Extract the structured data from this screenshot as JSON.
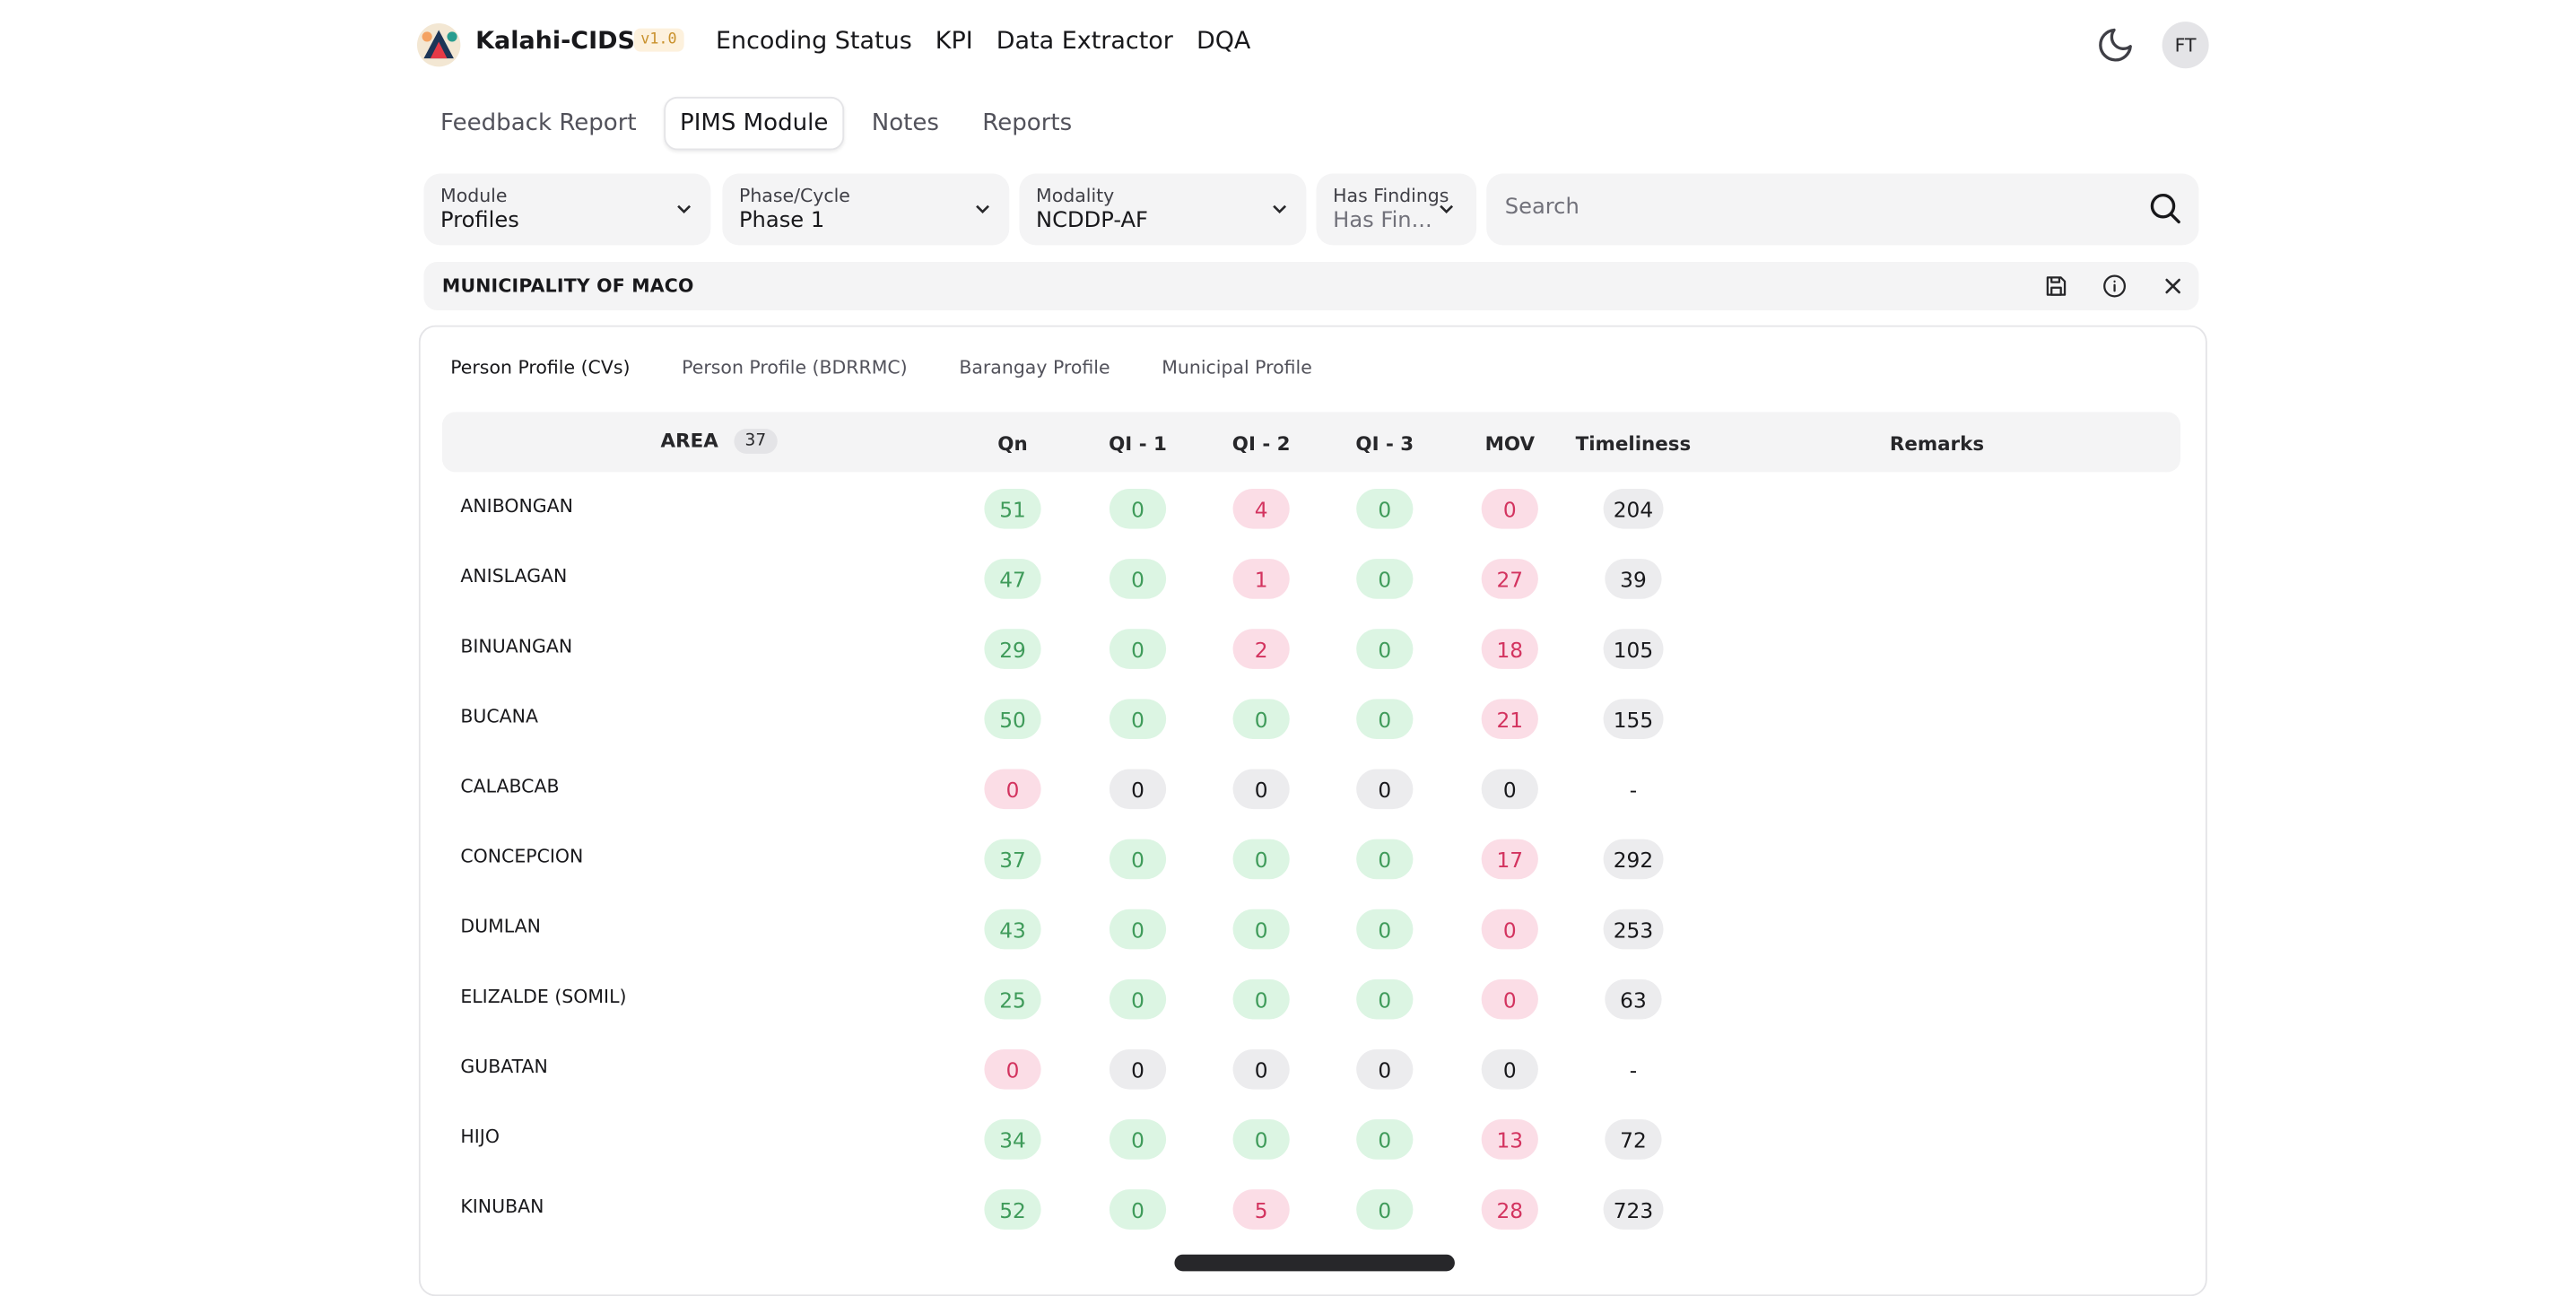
{
  "app": {
    "brand": "Kalahi-CIDSS",
    "version": "v1.0",
    "user_initials": "FT"
  },
  "nav": [
    "Encoding Status",
    "KPI",
    "Data Extractor",
    "DQA"
  ],
  "subtabs": [
    {
      "label": "Feedback Report",
      "active": false
    },
    {
      "label": "PIMS Module",
      "active": true
    },
    {
      "label": "Notes",
      "active": false
    },
    {
      "label": "Reports",
      "active": false
    }
  ],
  "filters": {
    "module": {
      "label": "Module",
      "value": "Profiles"
    },
    "phase": {
      "label": "Phase/Cycle",
      "value": "Phase 1"
    },
    "modality": {
      "label": "Modality",
      "value": "NCDDP-AF"
    },
    "findings": {
      "label": "Has Findings",
      "placeholder": "Has Fin..."
    },
    "search": {
      "placeholder": "Search"
    }
  },
  "municipality": "MUNICIPALITY OF MACO",
  "profile_tabs": [
    "Person Profile (CVs)",
    "Person Profile (BDRRMC)",
    "Barangay Profile",
    "Municipal Profile"
  ],
  "table": {
    "headers": {
      "area": "AREA",
      "area_count": "37",
      "qn": "Qn",
      "qi1": "QI - 1",
      "qi2": "QI - 2",
      "qi3": "QI - 3",
      "mov": "MOV",
      "timeliness": "Timeliness",
      "remarks": "Remarks"
    },
    "rows": [
      {
        "area": "ANIBONGAN",
        "qn": "51",
        "qi1": "0",
        "qi2": "4",
        "qi3": "0",
        "mov": "0",
        "timeliness": "204"
      },
      {
        "area": "ANISLAGAN",
        "qn": "47",
        "qi1": "0",
        "qi2": "1",
        "qi3": "0",
        "mov": "27",
        "timeliness": "39"
      },
      {
        "area": "BINUANGAN",
        "qn": "29",
        "qi1": "0",
        "qi2": "2",
        "qi3": "0",
        "mov": "18",
        "timeliness": "105"
      },
      {
        "area": "BUCANA",
        "qn": "50",
        "qi1": "0",
        "qi2": "0",
        "qi3": "0",
        "mov": "21",
        "timeliness": "155"
      },
      {
        "area": "CALABCAB",
        "qn": "0",
        "qi1": "0",
        "qi2": "0",
        "qi3": "0",
        "mov": "0",
        "timeliness": "-"
      },
      {
        "area": "CONCEPCION",
        "qn": "37",
        "qi1": "0",
        "qi2": "0",
        "qi3": "0",
        "mov": "17",
        "timeliness": "292"
      },
      {
        "area": "DUMLAN",
        "qn": "43",
        "qi1": "0",
        "qi2": "0",
        "qi3": "0",
        "mov": "0",
        "timeliness": "253"
      },
      {
        "area": "ELIZALDE (SOMIL)",
        "qn": "25",
        "qi1": "0",
        "qi2": "0",
        "qi3": "0",
        "mov": "0",
        "timeliness": "63"
      },
      {
        "area": "GUBATAN",
        "qn": "0",
        "qi1": "0",
        "qi2": "0",
        "qi3": "0",
        "mov": "0",
        "timeliness": "-"
      },
      {
        "area": "HIJO",
        "qn": "34",
        "qi1": "0",
        "qi2": "0",
        "qi3": "0",
        "mov": "13",
        "timeliness": "72"
      },
      {
        "area": "KINUBAN",
        "qn": "52",
        "qi1": "0",
        "qi2": "5",
        "qi3": "0",
        "mov": "28",
        "timeliness": "723"
      }
    ]
  },
  "colors": {
    "accent_green": "#3f9b5a",
    "accent_red": "#d3335f",
    "version_badge": "#c9912c"
  },
  "icons": {
    "logo": "kalahi-logo",
    "theme": "moon-icon",
    "search": "search-icon",
    "save": "save-icon",
    "info": "info-icon",
    "close": "close-icon"
  }
}
